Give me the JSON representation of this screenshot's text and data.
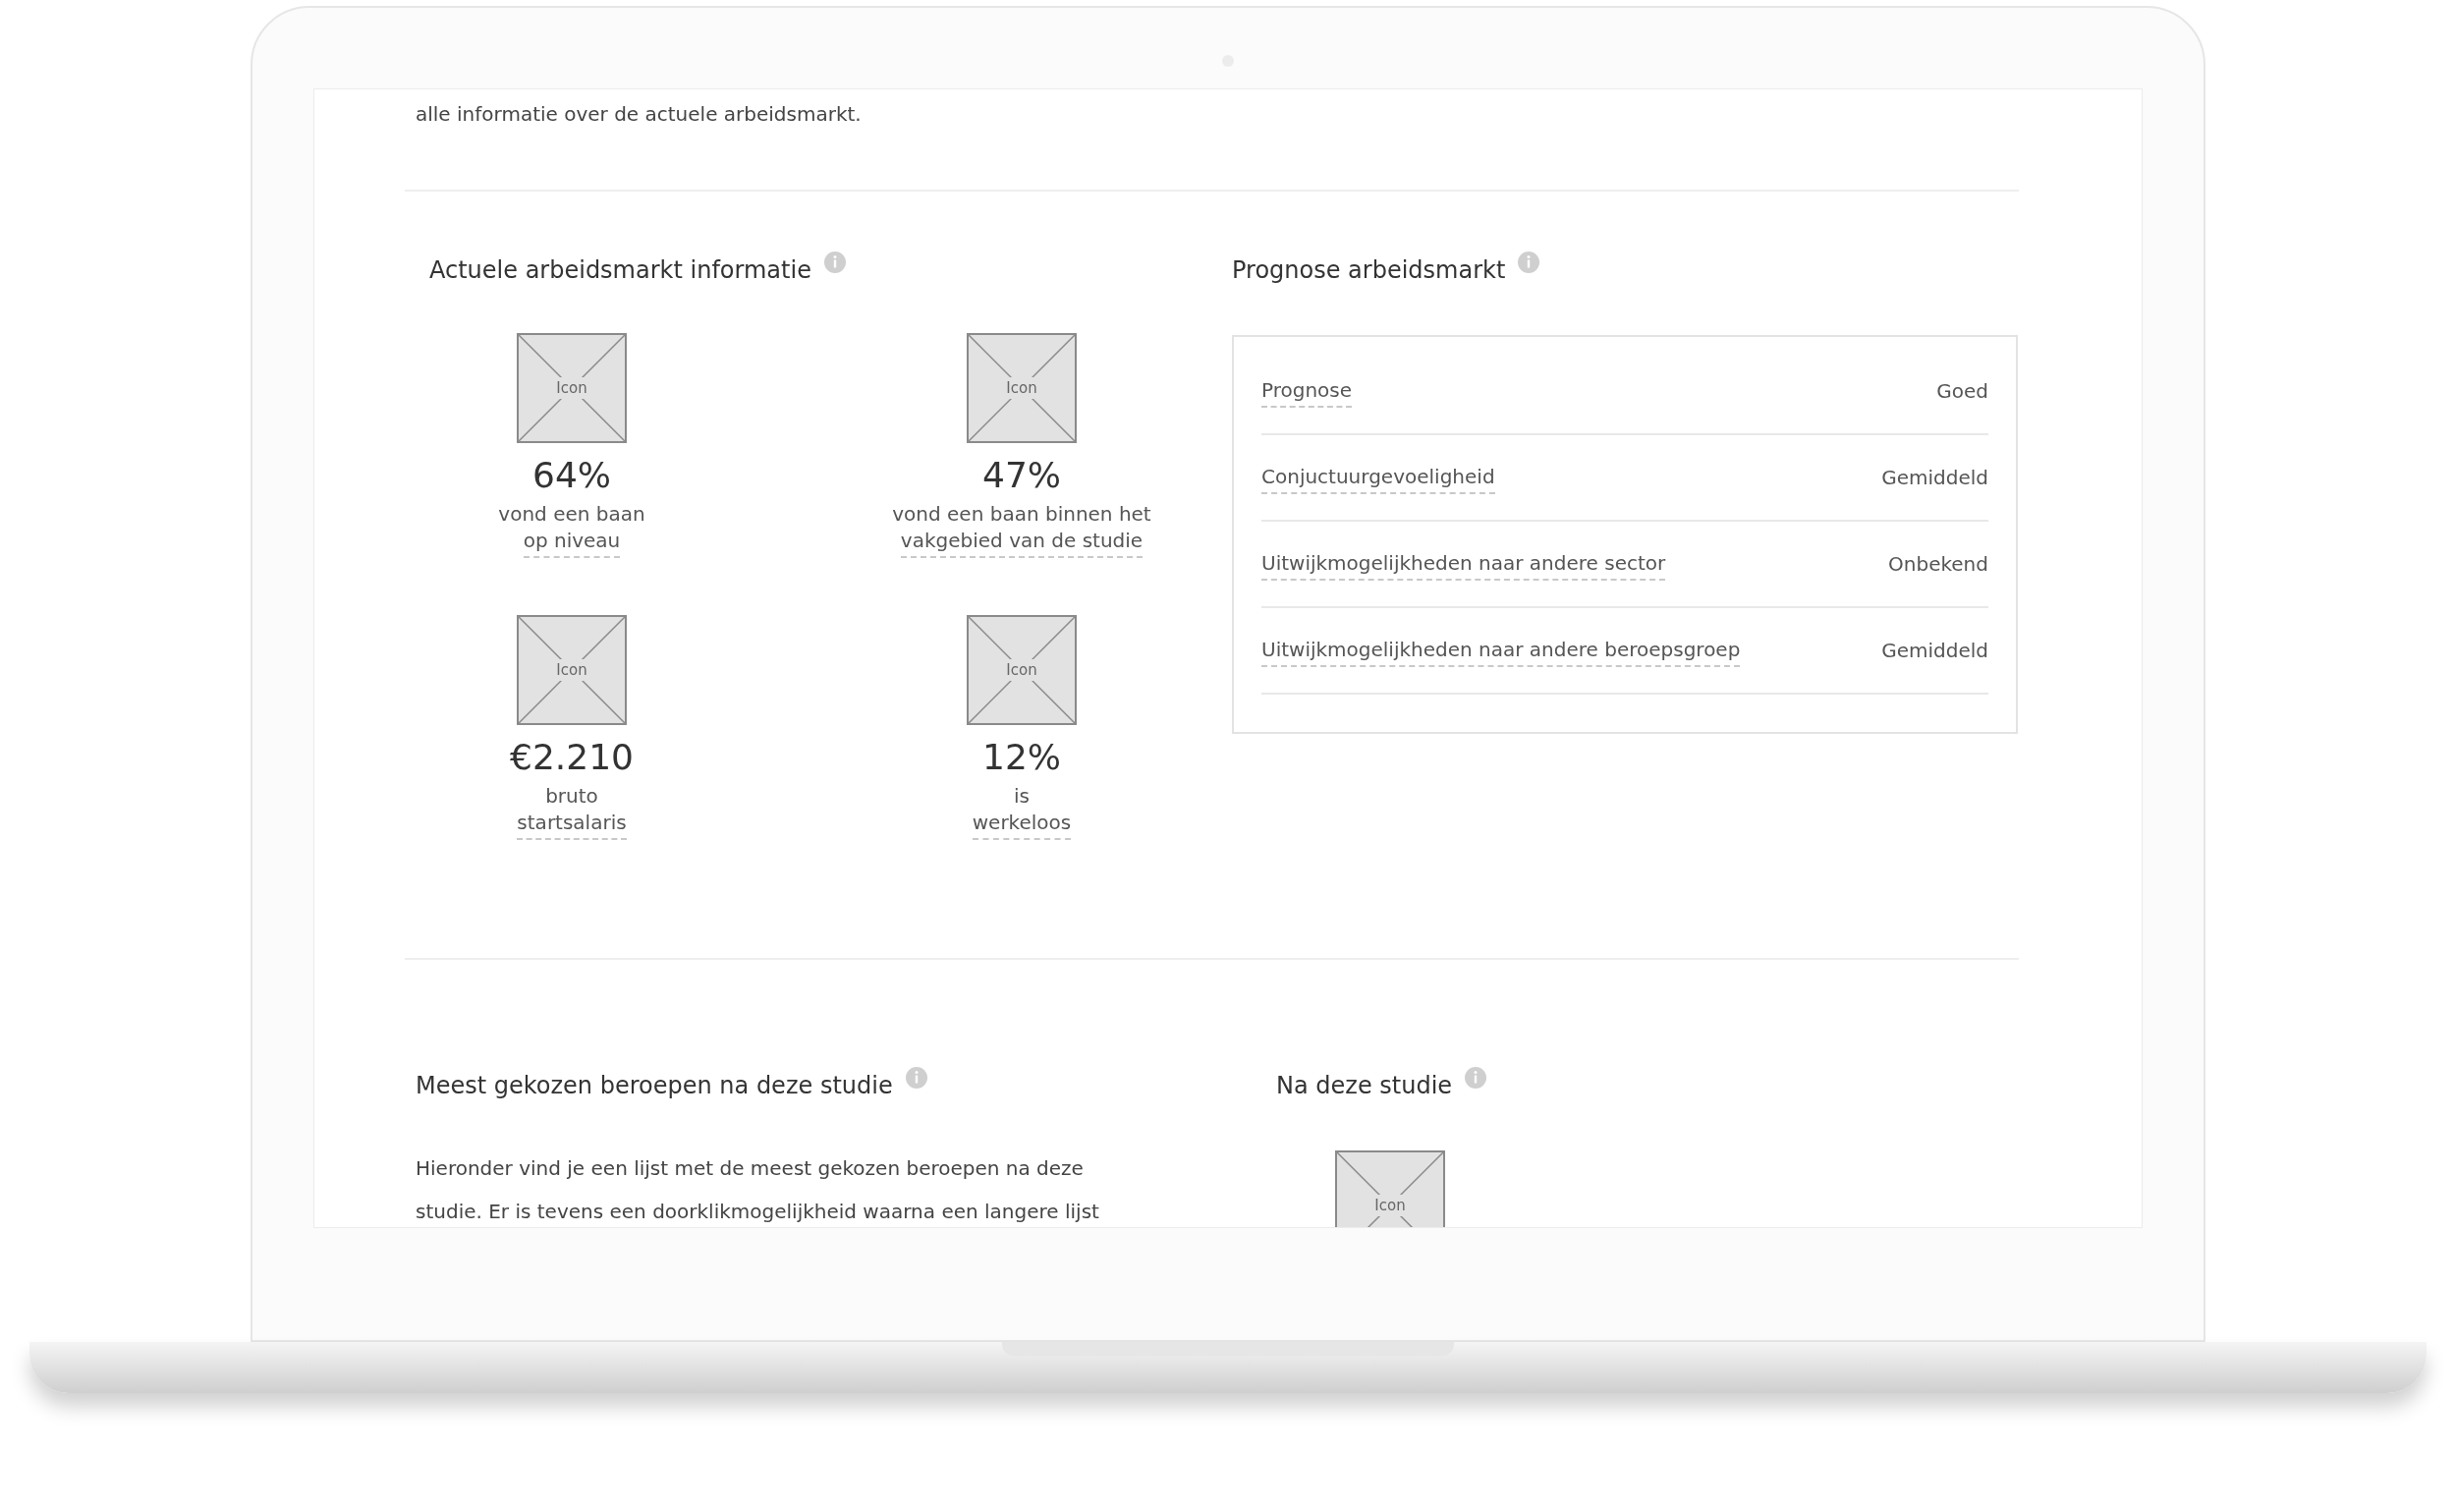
{
  "intro_text": "alle informatie over de actuele arbeidsmarkt.",
  "current_market": {
    "title": "Actuele arbeidsmarkt informatie",
    "stats": [
      {
        "icon_label": "Icon",
        "value": "64%",
        "line_1": "vond een baan",
        "line_2": "op niveau"
      },
      {
        "icon_label": "Icon",
        "value": "47%",
        "line_1": "vond een baan binnen het",
        "line_2": "vakgebied van de studie"
      },
      {
        "icon_label": "Icon",
        "value": "€2.210",
        "line_1": "bruto",
        "line_2": "startsalaris"
      },
      {
        "icon_label": "Icon",
        "value": "12%",
        "line_1": "is",
        "line_2": "werkeloos"
      }
    ]
  },
  "forecast": {
    "title": "Prognose arbeidsmarkt",
    "rows": [
      {
        "label": "Prognose",
        "value": "Goed"
      },
      {
        "label": "Conjuctuurgevoeligheid",
        "value": "Gemiddeld"
      },
      {
        "label": "Uitwijkmogelijkheden naar andere sector",
        "value": "Onbekend"
      },
      {
        "label": "Uitwijkmogelijkheden naar andere beroepsgroep",
        "value": "Gemiddeld"
      }
    ]
  },
  "professions": {
    "title": "Meest gekozen beroepen na deze studie",
    "lines": [
      "Hieronder vind je een lijst met de meest gekozen beroepen na deze",
      "studie. Er is tevens een doorklikmogelijkheid waarna een langere lijst"
    ]
  },
  "after_study": {
    "title": "Na deze studie",
    "icon_label": "Icon"
  }
}
